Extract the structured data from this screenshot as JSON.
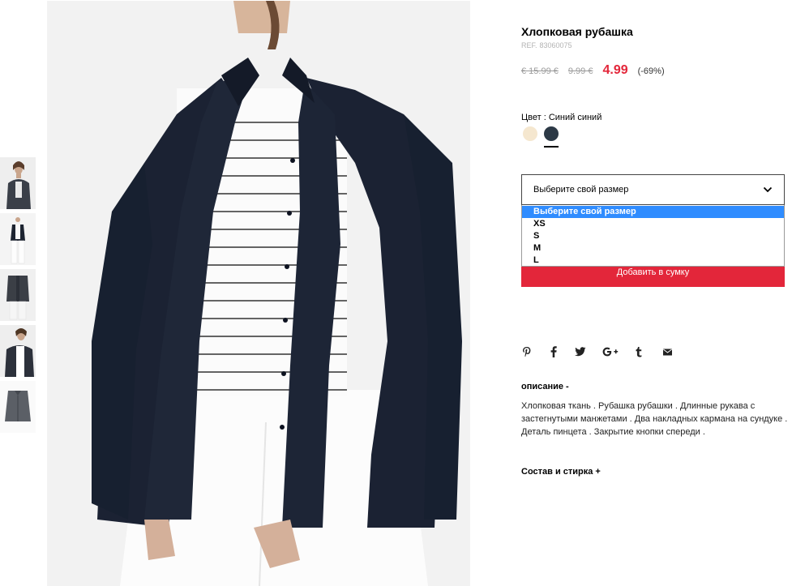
{
  "product": {
    "title": "Хлопковая рубашка",
    "ref_label": "REF.",
    "ref_number": "83060075"
  },
  "prices": {
    "original": "€ 15.99 €",
    "previous": "9.99 €",
    "sale": "4.99",
    "discount": "(-69%)",
    "sale_color": "#e3263a"
  },
  "color": {
    "label": "Цвет :",
    "selected": "Синий синий",
    "swatches": [
      {
        "name": "beige-swatch",
        "hex": "#f5e7cf"
      },
      {
        "name": "navy-swatch",
        "hex": "#2c3946",
        "selected": true
      }
    ]
  },
  "size": {
    "placeholder": "Выберите свой размер",
    "options": [
      "Выберите свой размер",
      "XS",
      "S",
      "M",
      "L"
    ],
    "highlighted_option": "Выберите свой размер"
  },
  "actions": {
    "add_to_bag": "Добавить в сумку"
  },
  "share_icons": [
    "pinterest-icon",
    "facebook-icon",
    "twitter-icon",
    "google-plus-icon",
    "tumblr-icon",
    "email-icon"
  ],
  "description": {
    "heading": "описание",
    "toggle": "-",
    "text": "Хлопковая ткань . Рубашка рубашки . Длинные рукава с застегнутыми манжетами . Два накладных кармана на сундуке . Деталь пинцета . Закрытие кнопки спереди ."
  },
  "composition": {
    "heading": "Состав и стирка",
    "toggle": "+"
  },
  "gallery": {
    "thumbnail_count": 5,
    "selected_thumbnail": 2
  }
}
